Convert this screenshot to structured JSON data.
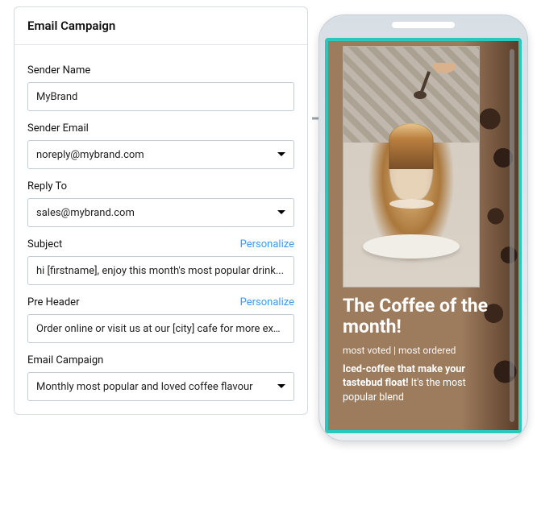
{
  "form": {
    "title": "Email Campaign",
    "sender_name": {
      "label": "Sender Name",
      "value": "MyBrand"
    },
    "sender_email": {
      "label": "Sender Email",
      "value": "noreply@mybrand.com"
    },
    "reply_to": {
      "label": "Reply To",
      "value": "sales@mybrand.com"
    },
    "subject": {
      "label": "Subject",
      "value": "hi [firstname], enjoy this month's most popular drink...",
      "personalize": "Personalize"
    },
    "pre_header": {
      "label": "Pre Header",
      "value": "Order online or visit us at our [city] cafe for more exc...",
      "personalize": "Personalize"
    },
    "campaign": {
      "label": "Email Campaign",
      "value": "Monthly most popular and loved coffee flavour"
    }
  },
  "preview": {
    "title": "The Coffee of the month!",
    "subtitle": "most voted | most ordered",
    "body_bold": "Iced-coffee that make your tastebud float!",
    "body_rest": " It's the most popular blend"
  }
}
